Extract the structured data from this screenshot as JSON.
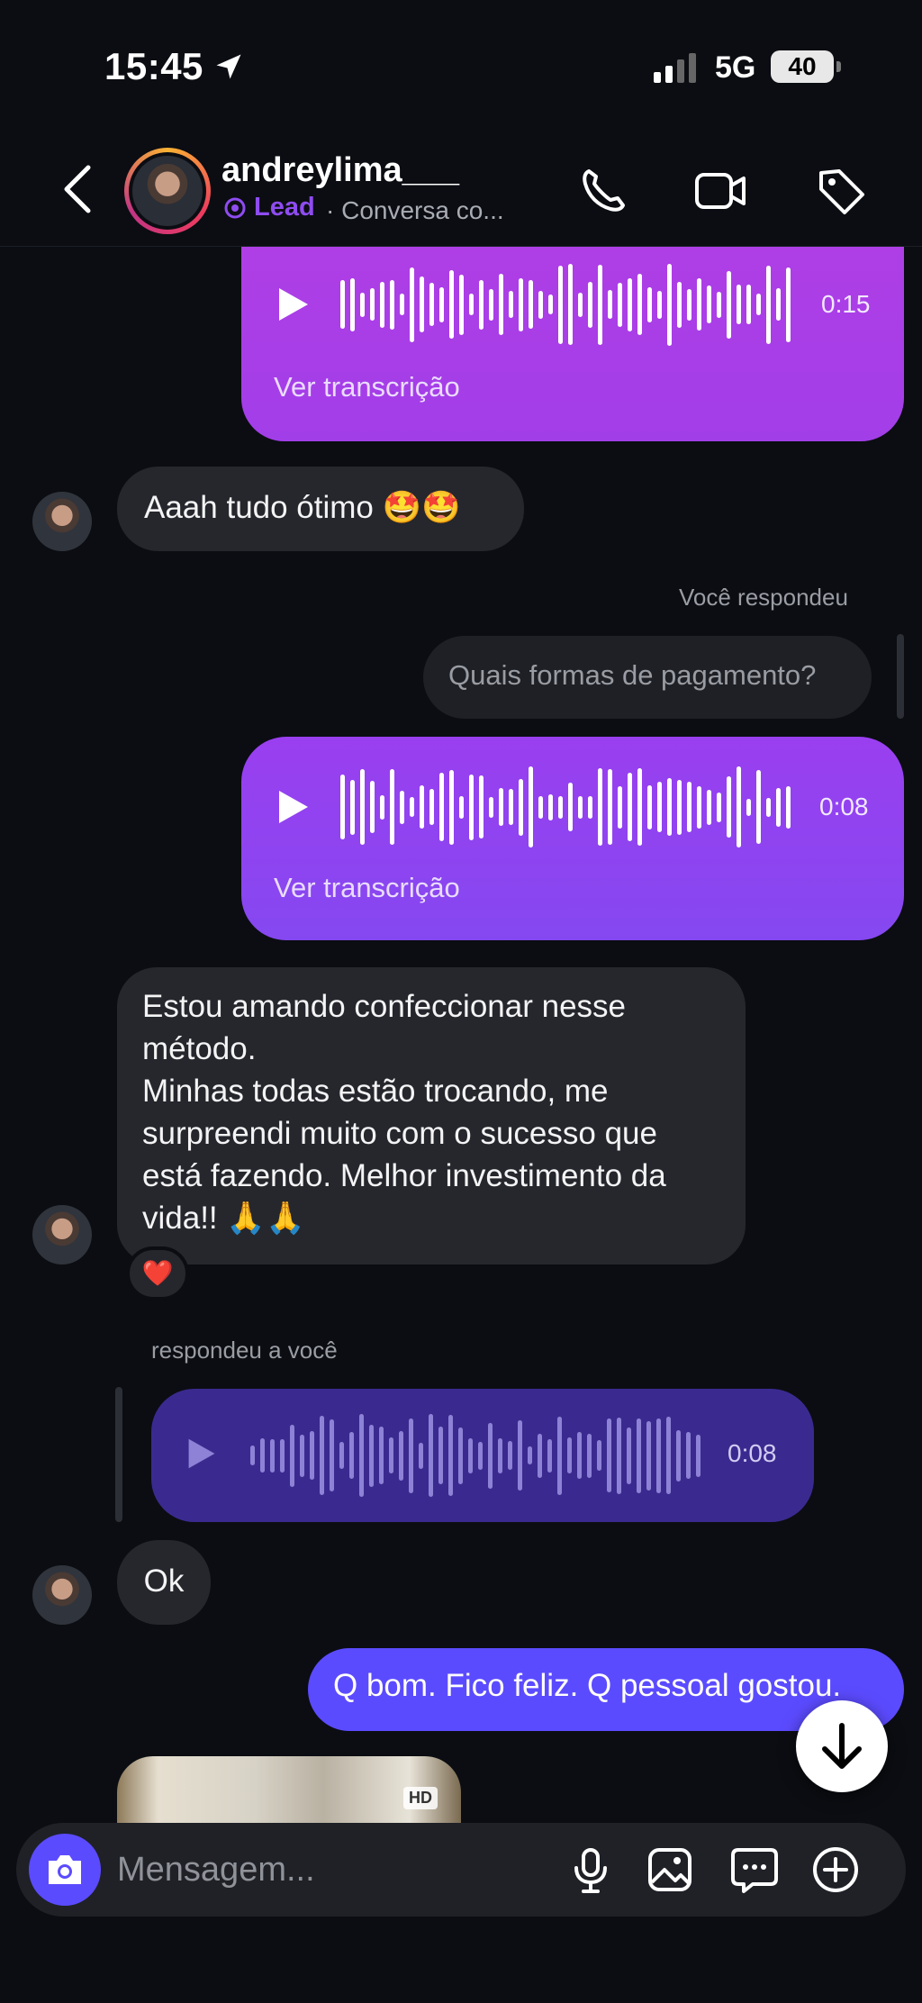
{
  "status_bar": {
    "time": "15:45",
    "network": "5G",
    "battery": "40",
    "icons": [
      "location-arrow-icon",
      "signal-bars-icon"
    ]
  },
  "header": {
    "contact_name": "andreylima___",
    "lead_label": "Lead",
    "subtitle": "· Conversa co...",
    "icons": [
      "back-chevron-icon",
      "phone-icon",
      "video-camera-icon",
      "tag-icon"
    ]
  },
  "messages": {
    "audio_1": {
      "duration": "0:15",
      "transcript_label": "Ver transcrição"
    },
    "text_1": {
      "text": "Aaah tudo ótimo 🤩🤩"
    },
    "reply_context": {
      "label": "Você respondeu",
      "quoted": "Quais formas de pagamento?"
    },
    "audio_2": {
      "duration": "0:08",
      "transcript_label": "Ver transcrição"
    },
    "text_2": {
      "line1": "Estou amando confeccionar nesse",
      "line2": "método.",
      "line3": "Minhas todas estão trocando, me",
      "line4": "surpreendi muito com o sucesso que",
      "line5": "está fazendo. Melhor investimento da",
      "line6": "vida!! 🙏🙏",
      "reaction": "❤️"
    },
    "reply_to_you": {
      "label": "respondeu a você",
      "duration": "0:08"
    },
    "text_3": {
      "text": "Ok"
    },
    "text_4": {
      "text": "Q bom. Fico feliz. Q pessoal gostou."
    },
    "media": {
      "badge": "HD"
    }
  },
  "composer": {
    "placeholder": "Mensagem...",
    "icons": [
      "camera-icon",
      "microphone-icon",
      "image-icon",
      "chat-bubble-icon",
      "plus-circle-icon",
      "arrow-down-icon"
    ]
  },
  "colors": {
    "background": "#0b0d12",
    "accent_purple": "#8e4cf0",
    "bubble_gray": "#25272d",
    "outgoing_blue": "#5b4bff"
  }
}
